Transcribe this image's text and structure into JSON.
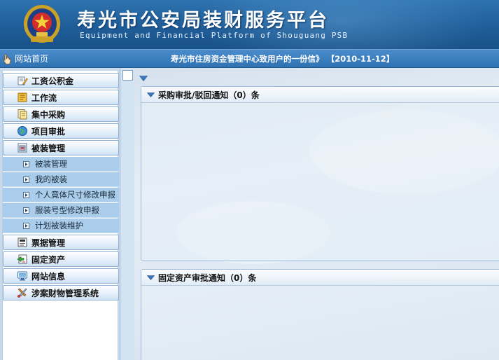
{
  "header": {
    "title": "寿光市公安局装财服务平台",
    "subtitle": "Equipment and Financial Platform of Shouguang PSB"
  },
  "navbar": {
    "home_label": "网站首页",
    "notice_text": "寿光市住房资金管理中心致用户的一份信》",
    "notice_date": "【2010-11-12】"
  },
  "sidebar": {
    "menus": [
      {
        "label": "工资公积金",
        "icon": "pen-icon"
      },
      {
        "label": "工作流",
        "icon": "workflow-icon"
      },
      {
        "label": "集中采购",
        "icon": "purchase-icon"
      },
      {
        "label": "项目审批",
        "icon": "globe-icon"
      },
      {
        "label": "被装管理",
        "icon": "uniform-icon"
      },
      {
        "label": "票据管理",
        "icon": "receipt-icon"
      },
      {
        "label": "固定资产",
        "icon": "asset-icon"
      },
      {
        "label": "网站信息",
        "icon": "info-icon"
      },
      {
        "label": "涉案财物管理系统",
        "icon": "tools-icon"
      }
    ],
    "subitems": [
      {
        "label": "被装管理"
      },
      {
        "label": "我的被装"
      },
      {
        "label": "个人竟体尺寸修改申报"
      },
      {
        "label": "服装号型修改申报"
      },
      {
        "label": "计划被装维护"
      }
    ]
  },
  "main": {
    "panels": [
      {
        "title": "采购审批/驳回通知（0）条"
      },
      {
        "title": "固定资产审批通知（0）条"
      }
    ]
  }
}
